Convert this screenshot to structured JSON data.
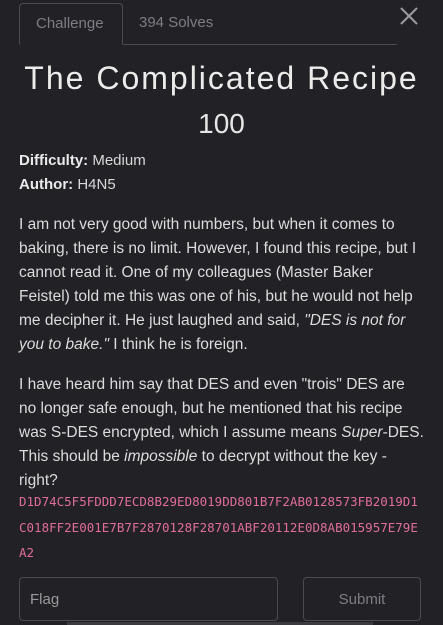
{
  "tabs": [
    {
      "label": "Challenge"
    },
    {
      "label": "394 Solves"
    }
  ],
  "challenge": {
    "title": "The Complicated Recipe",
    "points": "100",
    "difficulty_label": "Difficulty:",
    "difficulty_value": "Medium",
    "author_label": "Author:",
    "author_value": "H4N5"
  },
  "description": {
    "p1_a": "I am not very good with numbers, but when it comes to baking, there is no limit. However, I found this recipe, but I cannot read it. One of my colleagues (Master Baker Feistel) told me this was one of his, but he would not help me decipher it. He just laughed and said, ",
    "p1_quote": "\"DES is not for you to bake.\"",
    "p1_b": " I think he is foreign.",
    "p2_a": "I have heard him say that DES and even \"trois\" DES are no longer safe enough, but he mentioned that his recipe was S-DES encrypted, which I assume means ",
    "p2_em": "Super",
    "p2_b": "-DES. This should be ",
    "p2_em2": "impossible",
    "p2_c": " to decrypt without the key - right?"
  },
  "ciphertext": "D1D74C5F5FDDD7ECD8B29ED8019DD801B7F2AB0128573FB2019D1C018FF2E001E7B7F2870128F28701ABF20112E0D8AB015957E79EA2",
  "form": {
    "flag_placeholder": "Flag",
    "submit_label": "Submit"
  },
  "icons": {
    "close": "close-icon"
  }
}
